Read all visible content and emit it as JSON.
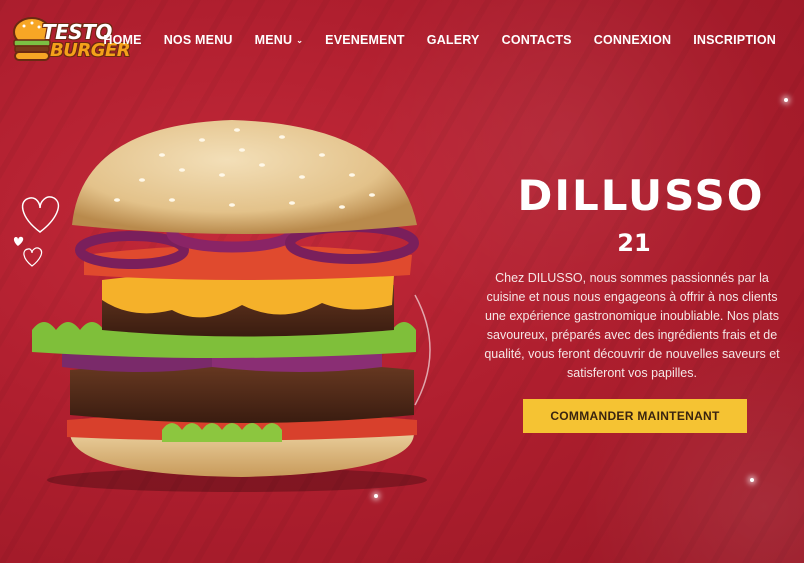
{
  "logo": {
    "line1": "TESTO",
    "line2": "BURGER"
  },
  "nav": {
    "items": [
      {
        "label": "HOME"
      },
      {
        "label": "NOS MENU"
      },
      {
        "label": "MENU",
        "has_dropdown": true
      },
      {
        "label": "EVENEMENT"
      },
      {
        "label": "GALERY"
      },
      {
        "label": "CONTACTS"
      },
      {
        "label": "CONNEXION"
      },
      {
        "label": "INSCRIPTION"
      }
    ],
    "dropdown_glyph": "⌄"
  },
  "hero": {
    "title": "DILLUSSO",
    "number": "21",
    "description": "Chez DILUSSO, nous sommes passionnés par la cuisine et nous nous engageons à offrir à nos clients une expérience gastronomique inoubliable. Nos plats savoureux, préparés avec des ingrédients frais et de qualité, vous feront découvrir de nouvelles saveurs et satisferont vos papilles.",
    "cta_label": "COMMANDER MAINTENANT"
  },
  "colors": {
    "background": "#b01f2f",
    "cta": "#f5c333",
    "cta_text": "#3a2410",
    "logo_accent": "#f4a11a"
  },
  "icons": [
    "burger-logo-icon",
    "heart-outline-icon",
    "chevron-down-icon"
  ]
}
